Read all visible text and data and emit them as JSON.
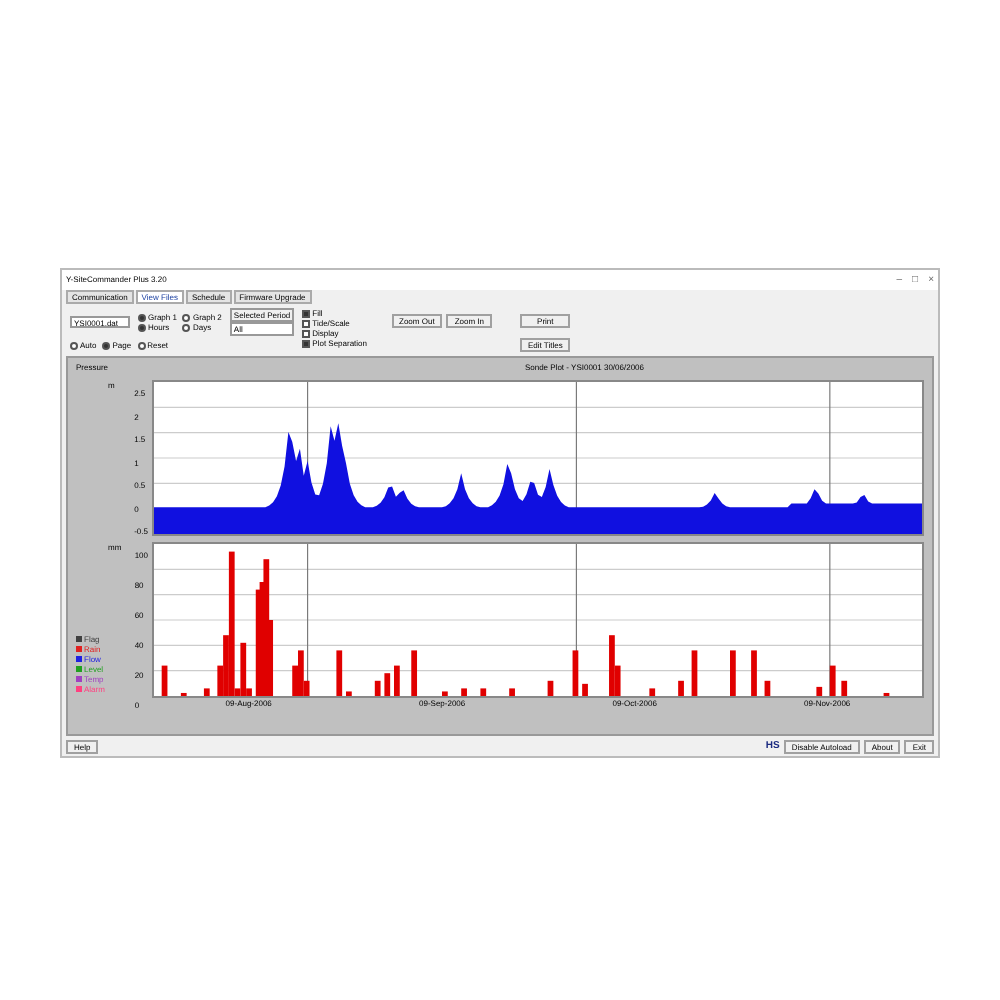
{
  "window": {
    "title": "Y-SiteCommander Plus 3.20",
    "controls": [
      "–",
      "□",
      "×"
    ]
  },
  "tabs": [
    {
      "label": "Communication",
      "selected": false
    },
    {
      "label": "View Files",
      "selected": true
    },
    {
      "label": "Schedule",
      "selected": false
    },
    {
      "label": "Firmware Upgrade",
      "selected": false
    }
  ],
  "file_select": {
    "value": "YSI0001.dat"
  },
  "options_row1": [
    {
      "label": "Graph 1",
      "checked": true
    },
    {
      "label": "Graph 2",
      "checked": false
    },
    {
      "label": "Hours",
      "checked": true
    },
    {
      "label": "Days",
      "checked": false
    }
  ],
  "period": {
    "label": "Selected Period",
    "value": "All"
  },
  "options_row2": [
    {
      "label": "Auto",
      "checked": false
    },
    {
      "label": "Page",
      "checked": true
    },
    {
      "label": "Reset",
      "checked": false
    }
  ],
  "plot_options": [
    {
      "label": "Fill",
      "checked": true
    },
    {
      "label": "Tide/Scale",
      "checked": false
    },
    {
      "label": "Display",
      "checked": false
    },
    {
      "label": "Plot Separation",
      "checked": true
    }
  ],
  "buttons": [
    "Zoom Out",
    "Zoom In",
    "Print",
    "Edit Titles"
  ],
  "chart": {
    "title": "Sonde Plot - YSI0001 30/06/2006",
    "top_label": "Pressure",
    "top_unit": "m",
    "top_ticks": [
      "2.5",
      "2",
      "1.5",
      "1",
      "0.5",
      "0",
      "-0.5"
    ],
    "bottom_unit": "mm",
    "bottom_ticks": [
      "100",
      "80",
      "60",
      "40",
      "20",
      "0"
    ],
    "dates": [
      "09-Aug-2006",
      "09-Sep-2006",
      "09-Oct-2006",
      "09-Nov-2006"
    ],
    "legend": [
      {
        "label": "Flag",
        "color": "#404040"
      },
      {
        "label": "Rain",
        "color": "#e02020"
      },
      {
        "label": "Flow",
        "color": "#2020e0"
      },
      {
        "label": "Level",
        "color": "#20a020"
      },
      {
        "label": "Temp",
        "color": "#a040c0"
      },
      {
        "label": "Alarm",
        "color": "#ff4080"
      }
    ]
  },
  "footer": {
    "help": "Help",
    "logo": "HS",
    "buttons": [
      "Disable Autoload",
      "About",
      "Exit"
    ]
  }
}
